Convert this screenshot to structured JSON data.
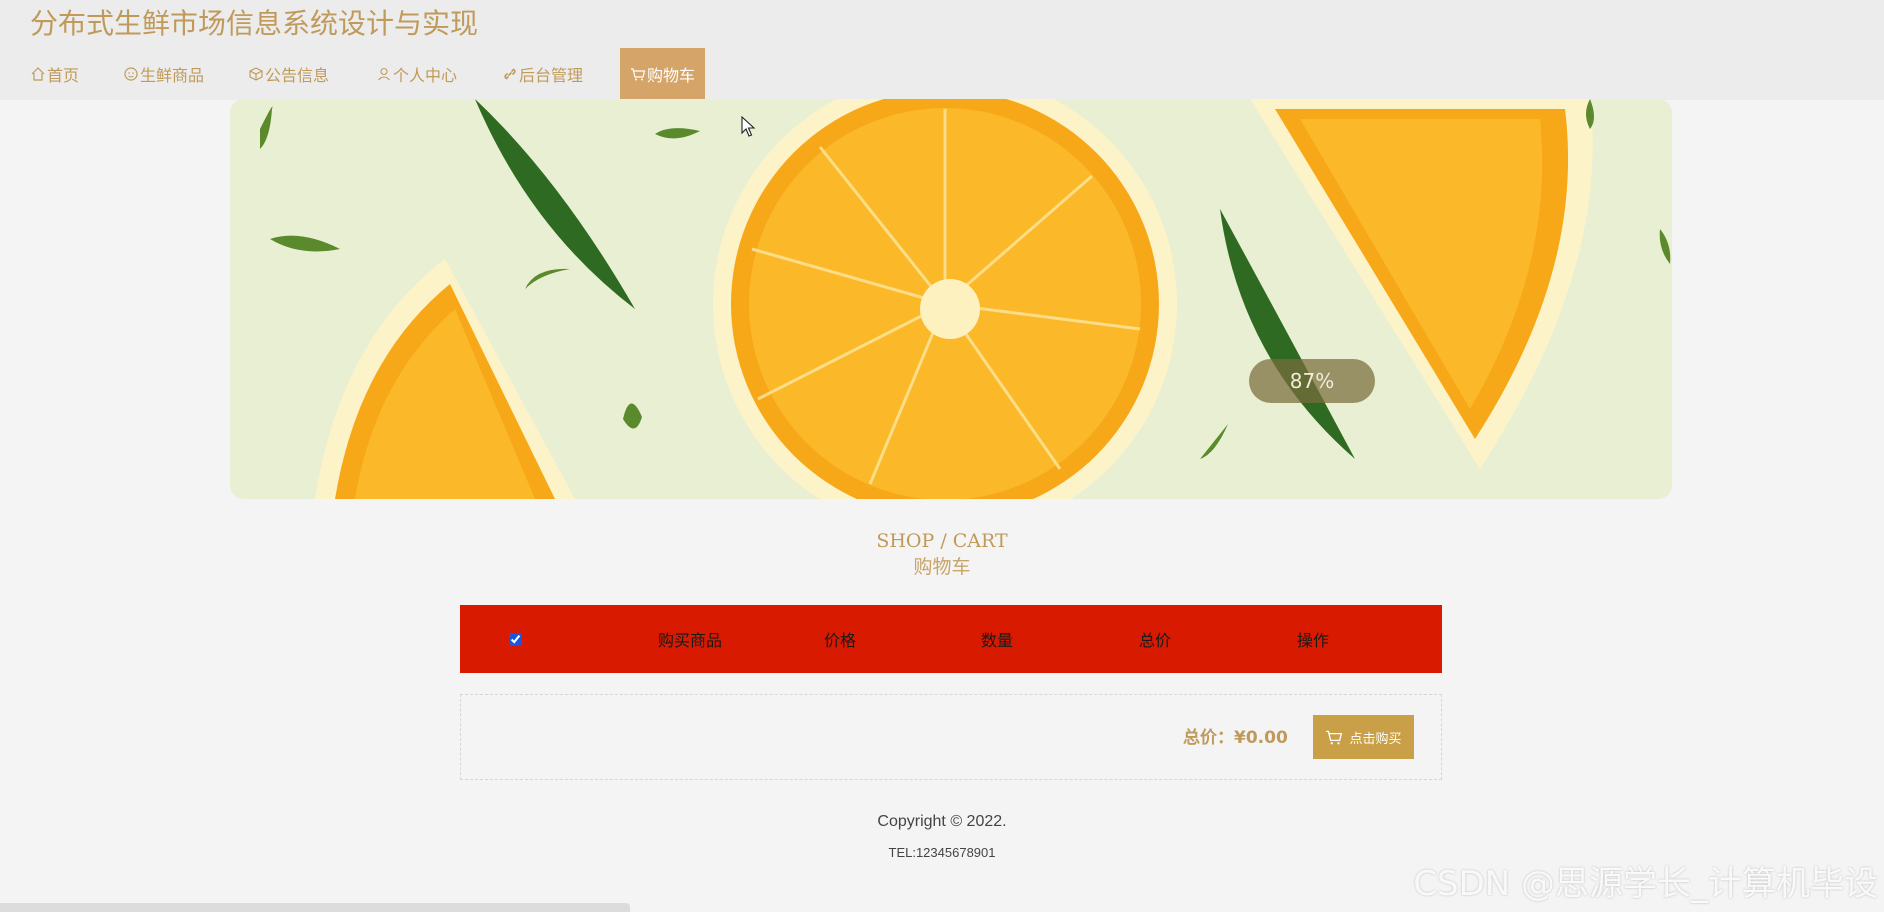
{
  "site": {
    "title": "分布式生鲜市场信息系统设计与实现"
  },
  "nav": {
    "items": [
      {
        "label": "首页",
        "icon": "home-icon"
      },
      {
        "label": "生鲜商品",
        "icon": "smile-icon"
      },
      {
        "label": "公告信息",
        "icon": "box-icon"
      },
      {
        "label": "个人中心",
        "icon": "user-icon"
      },
      {
        "label": "后台管理",
        "icon": "link-icon"
      },
      {
        "label": "购物车",
        "icon": "cart-icon",
        "active": true
      }
    ]
  },
  "banner": {
    "progress_text": "87%",
    "progress": 0.87
  },
  "section": {
    "title_en": "SHOP / CART",
    "title_cn": "购物车"
  },
  "cart": {
    "select_all_checked": true,
    "columns": [
      "购买商品",
      "价格",
      "数量",
      "总价",
      "操作"
    ],
    "rows": [],
    "total_label": "总价：¥0.00",
    "buy_label": "点击购买"
  },
  "footer": {
    "copyright": "Copyright © 2022.",
    "tel": "TEL:12345678901"
  },
  "watermark": "CSDN @思源学长_计算机毕设",
  "colors": {
    "brand": "#c09a5a",
    "nav_active": "#d4a468",
    "cart_header": "#d71a00",
    "buy_button": "#c9a048"
  }
}
